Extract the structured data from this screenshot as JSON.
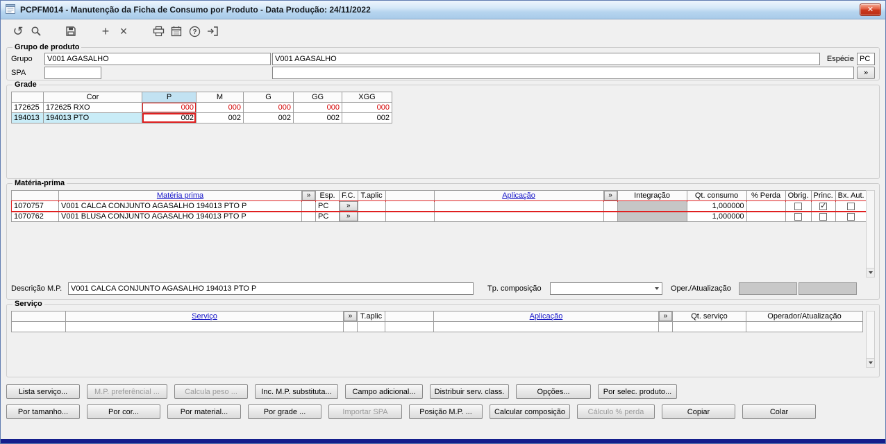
{
  "window": {
    "title": "PCPFM014 - Manutenção da Ficha de Consumo por Produto - Data Produção: 24/11/2022",
    "close_glyph": "✕"
  },
  "toolbar": {
    "icons": [
      "refresh",
      "search",
      "save",
      "add",
      "delete",
      "print",
      "calendar",
      "help",
      "exit"
    ],
    "refresh_glyph": "↺",
    "add_glyph": "+",
    "delete_glyph": "×"
  },
  "grupo_produto": {
    "legend": "Grupo de produto",
    "grupo_label": "Grupo",
    "grupo_code": "V001 AGASALHO",
    "grupo_descricao": "V001 AGASALHO",
    "especie_label": "Espécie",
    "especie_value": "PC",
    "spa_label": "SPA",
    "spa_code": "",
    "spa_descricao": "",
    "lookup_button": "»"
  },
  "grade": {
    "legend": "Grade",
    "columns": {
      "cor": "Cor",
      "p": "P",
      "m": "M",
      "g": "G",
      "gg": "GG",
      "xgg": "XGG"
    },
    "rows": [
      {
        "codigo": "172625",
        "cor": "172625 RXO",
        "p": "000",
        "m": "000",
        "g": "000",
        "gg": "000",
        "xgg": "000"
      },
      {
        "codigo": "194013",
        "cor": "194013 PTO",
        "p": "002",
        "m": "002",
        "g": "002",
        "gg": "002",
        "xgg": "002"
      }
    ]
  },
  "materia_prima": {
    "legend": "Matéria-prima",
    "columns": {
      "materia": "Matéria prima",
      "lookup": "»",
      "esp": "Esp.",
      "fc": "F.C.",
      "taplic": "T.aplic",
      "aplicacao": "Aplicação",
      "lookup2": "»",
      "integracao": "Integração",
      "qt_consumo": "Qt. consumo",
      "perda": "% Perda",
      "obrig": "Obrig.",
      "princ": "Princ.",
      "bx_aut": "Bx. Aut."
    },
    "rows": [
      {
        "codigo": "1070757",
        "materia": "V001 CALCA CONJUNTO AGASALHO 194013 PTO P",
        "esp": "PC",
        "fc": "»",
        "taplic": "",
        "aplicacao": "",
        "integracao": "",
        "qt_consumo": "1,000000",
        "perda": "",
        "obrig": false,
        "princ": true,
        "bx_aut": false
      },
      {
        "codigo": "1070762",
        "materia": "V001 BLUSA CONJUNTO AGASALHO 194013 PTO P",
        "esp": "PC",
        "fc": "»",
        "taplic": "",
        "aplicacao": "",
        "integracao": "",
        "qt_consumo": "1,000000",
        "perda": "",
        "obrig": false,
        "princ": false,
        "bx_aut": false
      }
    ],
    "descricao_label": "Descrição M.P.",
    "descricao_value": "V001 CALCA CONJUNTO AGASALHO 194013 PTO P",
    "tp_composicao_label": "Tp. composição",
    "tp_composicao_value": "",
    "oper_atualizacao_label": "Oper./Atualização",
    "oper_value_1": "",
    "oper_value_2": ""
  },
  "servico": {
    "legend": "Serviço",
    "columns": {
      "servico": "Serviço",
      "lookup": "»",
      "taplic": "T.aplic",
      "aplicacao": "Aplicação",
      "lookup2": "»",
      "qt_servico": "Qt. serviço",
      "operador": "Operador/Atualização"
    },
    "rows": [
      {
        "codigo": "",
        "servico": "",
        "taplic": "",
        "aplicacao": "",
        "qt_servico": "",
        "operador": ""
      }
    ]
  },
  "buttons": {
    "row1": [
      {
        "label": "Lista serviço...",
        "enabled": true
      },
      {
        "label": "M.P. preferêncial ...",
        "enabled": false
      },
      {
        "label": "Calcula peso ...",
        "enabled": false
      },
      {
        "label": "Inc. M.P. substituta...",
        "enabled": true
      },
      {
        "label": "Campo adicional...",
        "enabled": true
      },
      {
        "label": "Distribuir serv. class.",
        "enabled": true
      },
      {
        "label": "Opções...",
        "enabled": true
      },
      {
        "label": "Por selec. produto...",
        "enabled": true
      }
    ],
    "row2": [
      {
        "label": "Por tamanho...",
        "enabled": true
      },
      {
        "label": "Por cor...",
        "enabled": true
      },
      {
        "label": "Por material...",
        "enabled": true
      },
      {
        "label": "Por grade ...",
        "enabled": true
      },
      {
        "label": "Importar SPA",
        "enabled": false
      },
      {
        "label": "Posição M.P. ...",
        "enabled": true
      },
      {
        "label": "Calcular composição",
        "enabled": true
      },
      {
        "label": "Cálculo % perda",
        "enabled": false
      },
      {
        "label": "Copiar",
        "enabled": true
      },
      {
        "label": "Colar",
        "enabled": true
      }
    ]
  },
  "colors": {
    "titlebar_top": "#eef6fd",
    "titlebar_bottom": "#a8cbe9",
    "highlight_red": "#e02020",
    "selected_cell_bg": "#c9ecf7",
    "selected_col_bg": "#c2e2f2",
    "header_link_blue": "#1414c8",
    "negative_red": "#d40000",
    "disabled_field_bg": "#c8c8c8",
    "window_footer_navy": "#141e8c",
    "close_button_red": "#cb3a1e"
  }
}
